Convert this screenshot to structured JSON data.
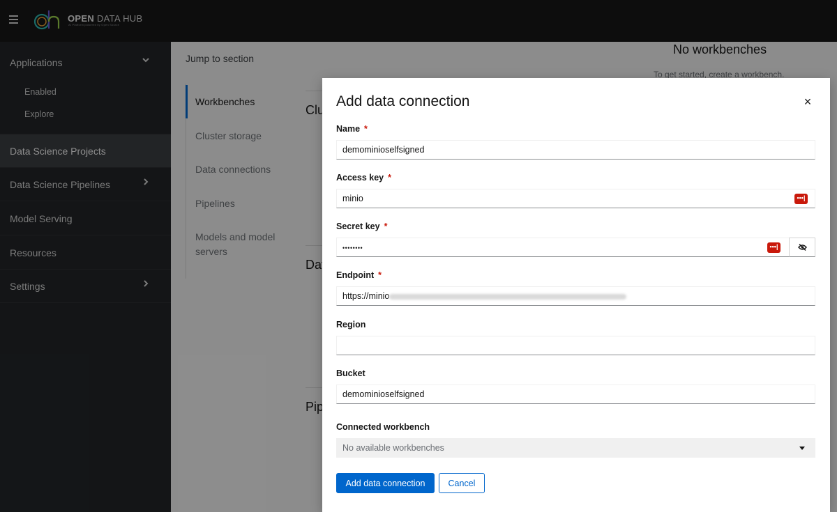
{
  "masthead": {
    "brand_bold": "OPEN",
    "brand_rest": "DATA HUB",
    "brand_sub": "AI Platform powered by Open Source"
  },
  "sidebar": {
    "items": [
      {
        "label": "Applications",
        "expanded": true
      },
      {
        "label": "Data Science Projects",
        "active": true
      },
      {
        "label": "Data Science Pipelines"
      },
      {
        "label": "Model Serving"
      },
      {
        "label": "Resources"
      },
      {
        "label": "Settings"
      }
    ],
    "sub_items": [
      "Enabled",
      "Explore"
    ]
  },
  "page": {
    "jump_title": "Jump to section",
    "jump_links": [
      "Workbenches",
      "Cluster storage",
      "Data connections",
      "Pipelines",
      "Models and model servers"
    ],
    "section_heads": [
      "Clu",
      "Dat",
      "Pip"
    ],
    "no_workbenches": "No workbenches",
    "no_workbenches_sub": "To get started, create a workbench."
  },
  "modal": {
    "title": "Add data connection",
    "close": "×",
    "fields": {
      "name": {
        "label": "Name",
        "value": "demominioselfsigned"
      },
      "access_key": {
        "label": "Access key",
        "value": "minio"
      },
      "secret_key": {
        "label": "Secret key",
        "value": "••••••••"
      },
      "endpoint": {
        "label": "Endpoint",
        "value": "https://minio"
      },
      "region": {
        "label": "Region",
        "value": ""
      },
      "bucket": {
        "label": "Bucket",
        "value": "demominioselfsigned"
      },
      "workbench": {
        "label": "Connected workbench",
        "value": "No available workbenches"
      }
    },
    "required_mark": "*",
    "submit_label": "Add data connection",
    "cancel_label": "Cancel"
  },
  "colors": {
    "primary": "#0066cc",
    "required": "#c9190b",
    "masthead": "#151515",
    "sidebar": "#212427"
  }
}
